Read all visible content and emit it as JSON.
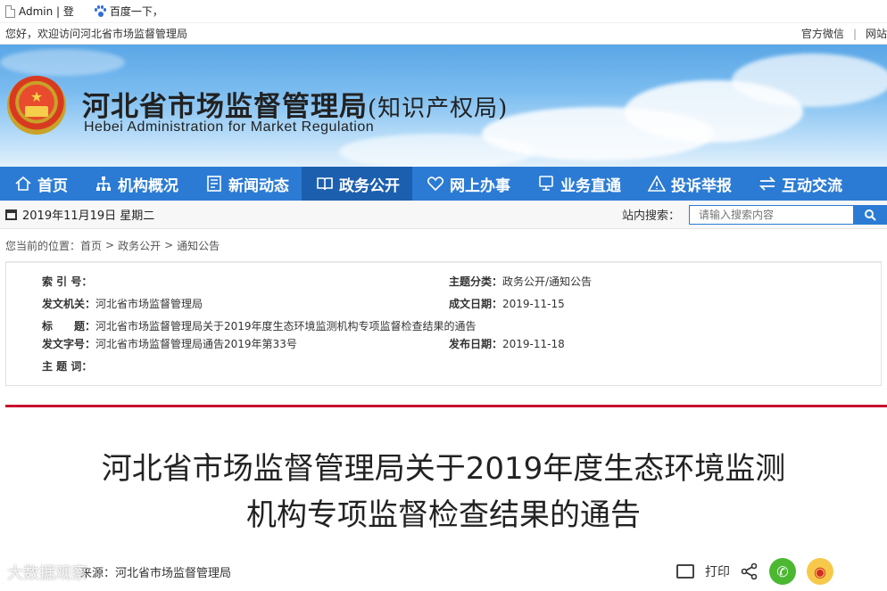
{
  "bookmarks": {
    "item1": "Admin | 登",
    "item2": "百度一下，"
  },
  "topbar": {
    "welcome": "您好，欢迎访问河北省市场监督管理局",
    "link1": "官方微信",
    "separator": "|",
    "link2": "网站"
  },
  "banner": {
    "title_cn": "河北省市场监督管理局",
    "title_cn_sub": "(知识产权局)",
    "title_en": "Hebei Administration for Market Regulation"
  },
  "nav": {
    "items": [
      {
        "label": "首页",
        "icon": "home-icon"
      },
      {
        "label": "机构概况",
        "icon": "org-chart-icon"
      },
      {
        "label": "新闻动态",
        "icon": "news-icon"
      },
      {
        "label": "政务公开",
        "icon": "open-book-icon",
        "active": true
      },
      {
        "label": "网上办事",
        "icon": "heart-icon"
      },
      {
        "label": "业务直通",
        "icon": "monitor-icon"
      },
      {
        "label": "投诉举报",
        "icon": "warning-icon"
      },
      {
        "label": "互动交流",
        "icon": "exchange-icon"
      }
    ],
    "colors": {
      "background": "#2b7bd4",
      "active": "#1c5fae"
    }
  },
  "datebar": {
    "date": "2019年11月19日 星期二",
    "search_label": "站内搜索：",
    "search_placeholder": "请输入搜索内容"
  },
  "breadcrumb": {
    "prefix": "您当前的位置：",
    "items": [
      "首页",
      "政务公开",
      "通知公告"
    ],
    "sep": ">"
  },
  "meta": {
    "index_label": "索 引 号：",
    "index_value": "",
    "topic_label": "主题分类：",
    "topic_value": "政务公开/通知公告",
    "issuer_label": "发文机关：",
    "issuer_value": "河北省市场监督管理局",
    "created_label": "成文日期：",
    "created_value": "2019-11-15",
    "title_label": "标　　题：",
    "title_value": "河北省市场监督管理局关于2019年度生态环境监测机构专项监督检查结果的通告",
    "docno_label": "发文字号：",
    "docno_value": "河北省市场监督管理局通告2019年第33号",
    "published_label": "发布日期：",
    "published_value": "2019-11-18",
    "keywords_label": "主 题 词："
  },
  "article": {
    "title_line1": "河北省市场监督管理局关于2019年度生态环境监测",
    "title_line2": "机构专项监督检查结果的通告",
    "source": "来源：河北省市场监督管理局",
    "print": "打印",
    "watermark": "大数据观察",
    "accent_color": "#c8102e"
  }
}
